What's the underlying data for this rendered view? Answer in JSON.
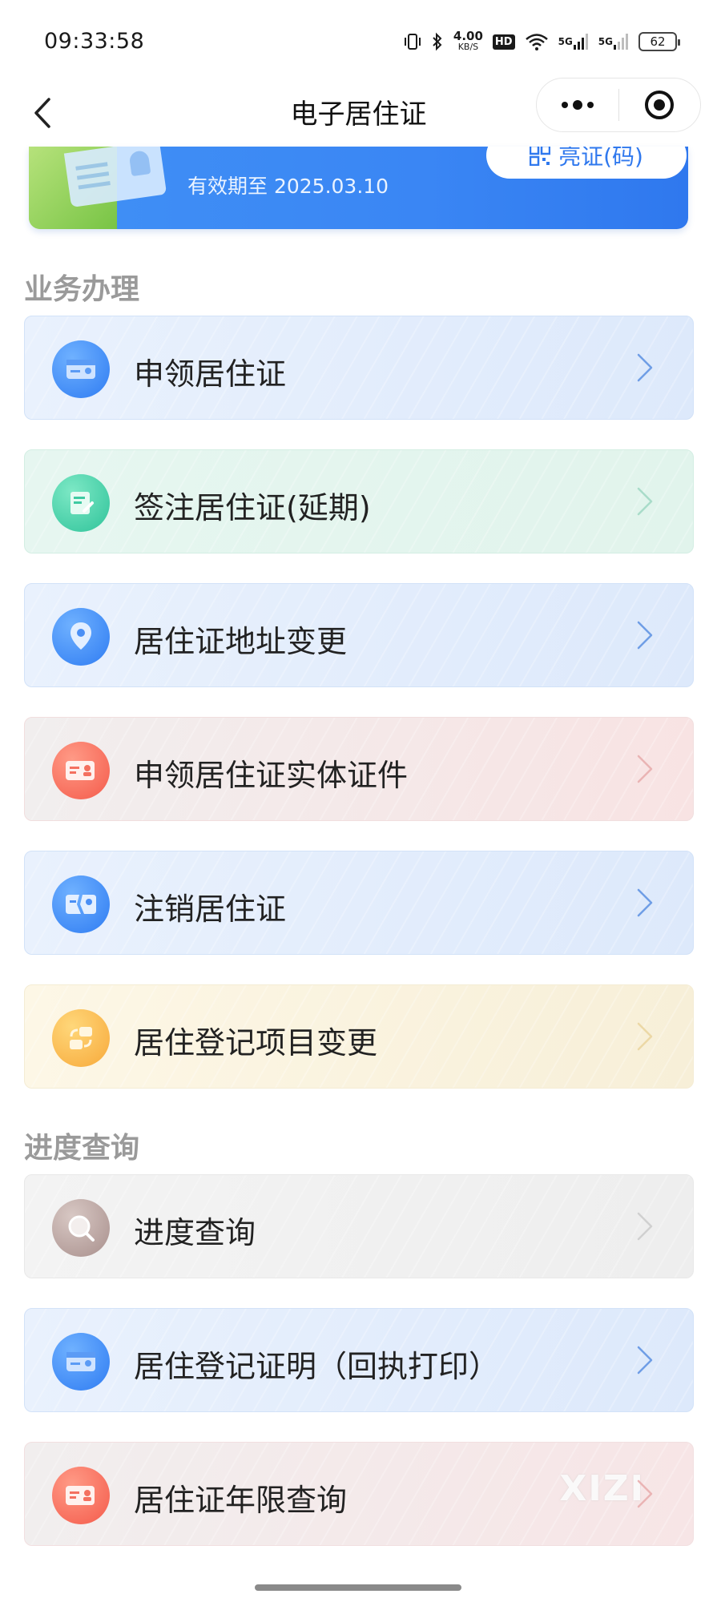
{
  "status_bar": {
    "time": "09:33:58",
    "net_speed_value": "4.00",
    "net_speed_unit": "KB/S",
    "hd_label": "HD",
    "signal1_label": "5G",
    "signal2_label": "5G",
    "battery": "62"
  },
  "nav": {
    "title": "电子居住证"
  },
  "card": {
    "validity": "有效期至 2025.03.10",
    "code_button": "亮证(码)"
  },
  "sections": {
    "business": "业务办理",
    "progress": "进度查询"
  },
  "business_items": [
    {
      "label": "申领居住证",
      "icon": "card-icon"
    },
    {
      "label": "签注居住证(延期)",
      "icon": "sign-document-icon"
    },
    {
      "label": "居住证地址变更",
      "icon": "location-pin-icon"
    },
    {
      "label": "申领居住证实体证件",
      "icon": "card-person-icon"
    },
    {
      "label": "注销居住证",
      "icon": "broken-card-icon"
    },
    {
      "label": "居住登记项目变更",
      "icon": "swap-icon"
    }
  ],
  "progress_items": [
    {
      "label": "进度查询",
      "icon": "search-icon"
    },
    {
      "label": "居住登记证明（回执打印）",
      "icon": "card-icon"
    },
    {
      "label": "居住证年限查询",
      "icon": "card-person-icon"
    }
  ],
  "watermark": "XIZI",
  "colors": {
    "accent_blue": "#2f78ee",
    "section_title": "#9a9a9a"
  }
}
